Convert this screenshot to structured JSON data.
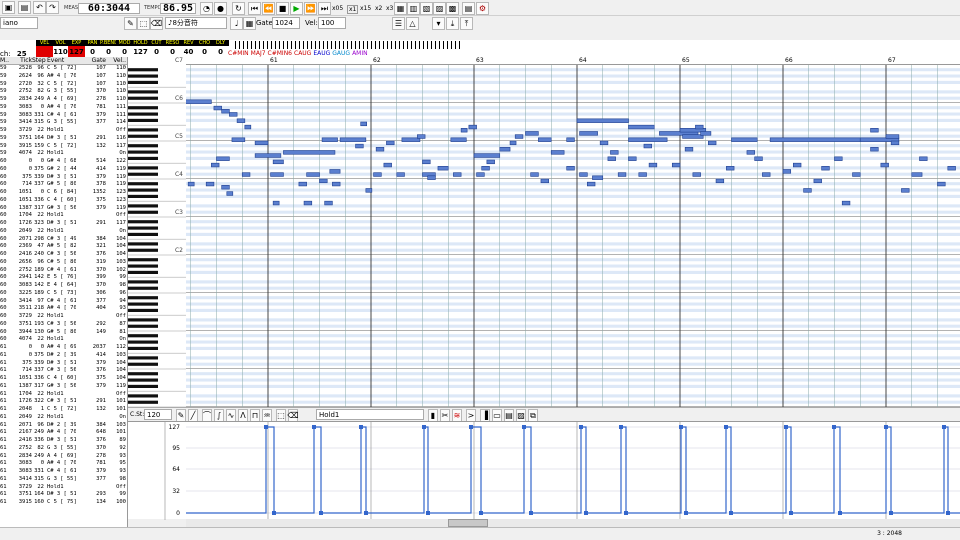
{
  "toolbar": {
    "meas_label": "MEAS",
    "position": "60:3044",
    "tempo_label": "TEMPO",
    "tempo": "86.95",
    "speed_x05": "x05",
    "speed_x1": "x1",
    "speed_x15": "x15",
    "speed_x2": "x2",
    "speed_x3": "x3",
    "instrument": "iano",
    "note_length": "8分音符",
    "gate_label": "Gate:",
    "gate": "1024",
    "vel_label": "Vel:",
    "vel": "100"
  },
  "mixer": {
    "channel_label": "ch:",
    "channel": "25",
    "params": [
      {
        "name": "VEL",
        "value": ""
      },
      {
        "name": "VOL",
        "value": "110"
      },
      {
        "name": "EXP",
        "value": "127"
      },
      {
        "name": "PAN",
        "value": "0"
      },
      {
        "name": "P.BEND",
        "value": "0"
      },
      {
        "name": "MOD",
        "value": "0"
      },
      {
        "name": "HOLD",
        "value": "127"
      },
      {
        "name": "CUT",
        "value": "0"
      },
      {
        "name": "RESO",
        "value": "0"
      },
      {
        "name": "REV",
        "value": "40"
      },
      {
        "name": "CHO",
        "value": "0"
      },
      {
        "name": "DLY",
        "value": "0"
      }
    ],
    "chords": [
      "C#MIN",
      "MAJ7",
      "C#MIN6",
      "CAUG",
      "EAUG",
      "GAUG",
      "AMIN"
    ]
  },
  "eventlist": {
    "headers": [
      "M..",
      "Tick",
      "Step",
      "Event",
      "Gate",
      "Vel.."
    ],
    "rows": [
      [
        "59",
        "2528",
        "96",
        "C 5 [ 72]",
        "107",
        "110"
      ],
      [
        "59",
        "2624",
        "96",
        "A# 4 [ 70]",
        "107",
        "110"
      ],
      [
        "59",
        "2720",
        "32",
        "C 5 [ 72]",
        "107",
        "110"
      ],
      [
        "59",
        "2752",
        "82",
        "G 3 [ 55]",
        "370",
        "110"
      ],
      [
        "59",
        "2834",
        "249",
        "A 4 [ 69]",
        "278",
        "110"
      ],
      [
        "59",
        "3083",
        "0",
        "A# 4 [ 70]",
        "781",
        "111"
      ],
      [
        "59",
        "3083",
        "331",
        "C# 4 [ 61]",
        "379",
        "111"
      ],
      [
        "59",
        "3414",
        "315",
        "G 3 [ 55]",
        "377",
        "114"
      ],
      [
        "59",
        "3729",
        "22",
        "Hold1",
        "",
        "Off"
      ],
      [
        "59",
        "3751",
        "164",
        "D# 3 [ 51]",
        "291",
        "116"
      ],
      [
        "59",
        "3915",
        "159",
        "C 5 [ 72]",
        "132",
        "117"
      ],
      [
        "59",
        "4074",
        "22",
        "Hold1",
        "",
        "On"
      ],
      [
        "60",
        "0",
        "0",
        "G# 4 [ 68]",
        "514",
        "122"
      ],
      [
        "60",
        "0",
        "375",
        "G# 2 [ 44]",
        "414",
        "119"
      ],
      [
        "60",
        "375",
        "339",
        "D# 3 [ 51]",
        "379",
        "119"
      ],
      [
        "60",
        "714",
        "337",
        "G# 5 [ 80]",
        "378",
        "119"
      ],
      [
        "60",
        "1051",
        "0",
        "C 6 [ 84]",
        "1352",
        "123"
      ],
      [
        "60",
        "1051",
        "336",
        "C 4 [ 60]",
        "375",
        "123"
      ],
      [
        "60",
        "1387",
        "317",
        "G# 3 [ 56]",
        "379",
        "119"
      ],
      [
        "60",
        "1704",
        "22",
        "Hold1",
        "",
        "Off"
      ],
      [
        "60",
        "1726",
        "323",
        "D# 3 [ 51]",
        "291",
        "117"
      ],
      [
        "60",
        "2049",
        "22",
        "Hold1",
        "",
        "On"
      ],
      [
        "60",
        "2071",
        "298",
        "C# 3 [ 49]",
        "384",
        "104"
      ],
      [
        "60",
        "2369",
        "47",
        "A# 5 [ 82]",
        "321",
        "104"
      ],
      [
        "60",
        "2416",
        "240",
        "C# 3 [ 56]",
        "376",
        "104"
      ],
      [
        "60",
        "2656",
        "96",
        "C# 5 [ 80]",
        "319",
        "103"
      ],
      [
        "60",
        "2752",
        "189",
        "C# 4 [ 61]",
        "370",
        "102"
      ],
      [
        "60",
        "2941",
        "142",
        "E 5 [ 76]",
        "399",
        "99"
      ],
      [
        "60",
        "3083",
        "142",
        "E 4 [ 64]",
        "370",
        "98"
      ],
      [
        "60",
        "3225",
        "189",
        "C 5 [ 73]",
        "306",
        "96"
      ],
      [
        "60",
        "3414",
        "97",
        "C# 4 [ 61]",
        "377",
        "94"
      ],
      [
        "60",
        "3511",
        "218",
        "A# 4 [ 70]",
        "404",
        "93"
      ],
      [
        "60",
        "3729",
        "22",
        "Hold1",
        "",
        "Off"
      ],
      [
        "60",
        "3751",
        "193",
        "C# 3 [ 56]",
        "292",
        "87"
      ],
      [
        "60",
        "3944",
        "130",
        "G# 5 [ 80]",
        "149",
        "81"
      ],
      [
        "60",
        "4074",
        "22",
        "Hold1",
        "",
        "On"
      ],
      [
        "61",
        "0",
        "0",
        "A# 4 [ 69]",
        "2037",
        "112"
      ],
      [
        "61",
        "0",
        "375",
        "D# 2 [ 39]",
        "414",
        "103"
      ],
      [
        "61",
        "375",
        "339",
        "D# 3 [ 51]",
        "379",
        "104"
      ],
      [
        "61",
        "714",
        "337",
        "C# 3 [ 56]",
        "376",
        "104"
      ],
      [
        "61",
        "1051",
        "336",
        "C 4 [ 60]",
        "375",
        "104"
      ],
      [
        "61",
        "1387",
        "317",
        "G# 3 [ 56]",
        "379",
        "119"
      ],
      [
        "61",
        "1704",
        "22",
        "Hold1",
        "",
        "Off"
      ],
      [
        "61",
        "1726",
        "322",
        "C# 3 [ 51]",
        "291",
        "101"
      ],
      [
        "61",
        "2048",
        "1",
        "C 5 [ 72]",
        "132",
        "101"
      ],
      [
        "61",
        "2049",
        "22",
        "Hold1",
        "",
        "On"
      ],
      [
        "61",
        "2071",
        "96",
        "D# 2 [ 39]",
        "384",
        "103"
      ],
      [
        "61",
        "2167",
        "249",
        "A# 4 [ 70]",
        "648",
        "101"
      ],
      [
        "61",
        "2416",
        "336",
        "D# 3 [ 51]",
        "376",
        "89"
      ],
      [
        "61",
        "2752",
        "82",
        "G 3 [ 55]",
        "370",
        "92"
      ],
      [
        "61",
        "2834",
        "249",
        "A 4 [ 69]",
        "278",
        "93"
      ],
      [
        "61",
        "3083",
        "0",
        "A# 4 [ 70]",
        "781",
        "95"
      ],
      [
        "61",
        "3083",
        "331",
        "C# 4 [ 61]",
        "379",
        "93"
      ],
      [
        "61",
        "3414",
        "315",
        "G 3 [ 55]",
        "377",
        "98"
      ],
      [
        "61",
        "3729",
        "22",
        "Hold1",
        "",
        "Off"
      ],
      [
        "61",
        "3751",
        "164",
        "D# 3 [ 51]",
        "293",
        "99"
      ],
      [
        "61",
        "3915",
        "160",
        "C 5 [ 75]",
        "134",
        "100"
      ]
    ]
  },
  "roll": {
    "measures": [
      "61",
      "62",
      "63",
      "64",
      "65",
      "66",
      "67"
    ],
    "octaves": [
      "C7",
      "C6",
      "C5",
      "C4",
      "C3",
      "C2"
    ]
  },
  "controller": {
    "start_label": "C.St:",
    "start": "120",
    "type": "Hold1",
    "ticks": [
      "127",
      "95",
      "64",
      "32",
      "0"
    ]
  },
  "status": {
    "position": "3 : 2048"
  },
  "colors": {
    "note_fill": "#5b7fcf",
    "note_border": "#1f3f8f",
    "mixer_red": "#e00000",
    "chord_text": "#cc0000"
  }
}
